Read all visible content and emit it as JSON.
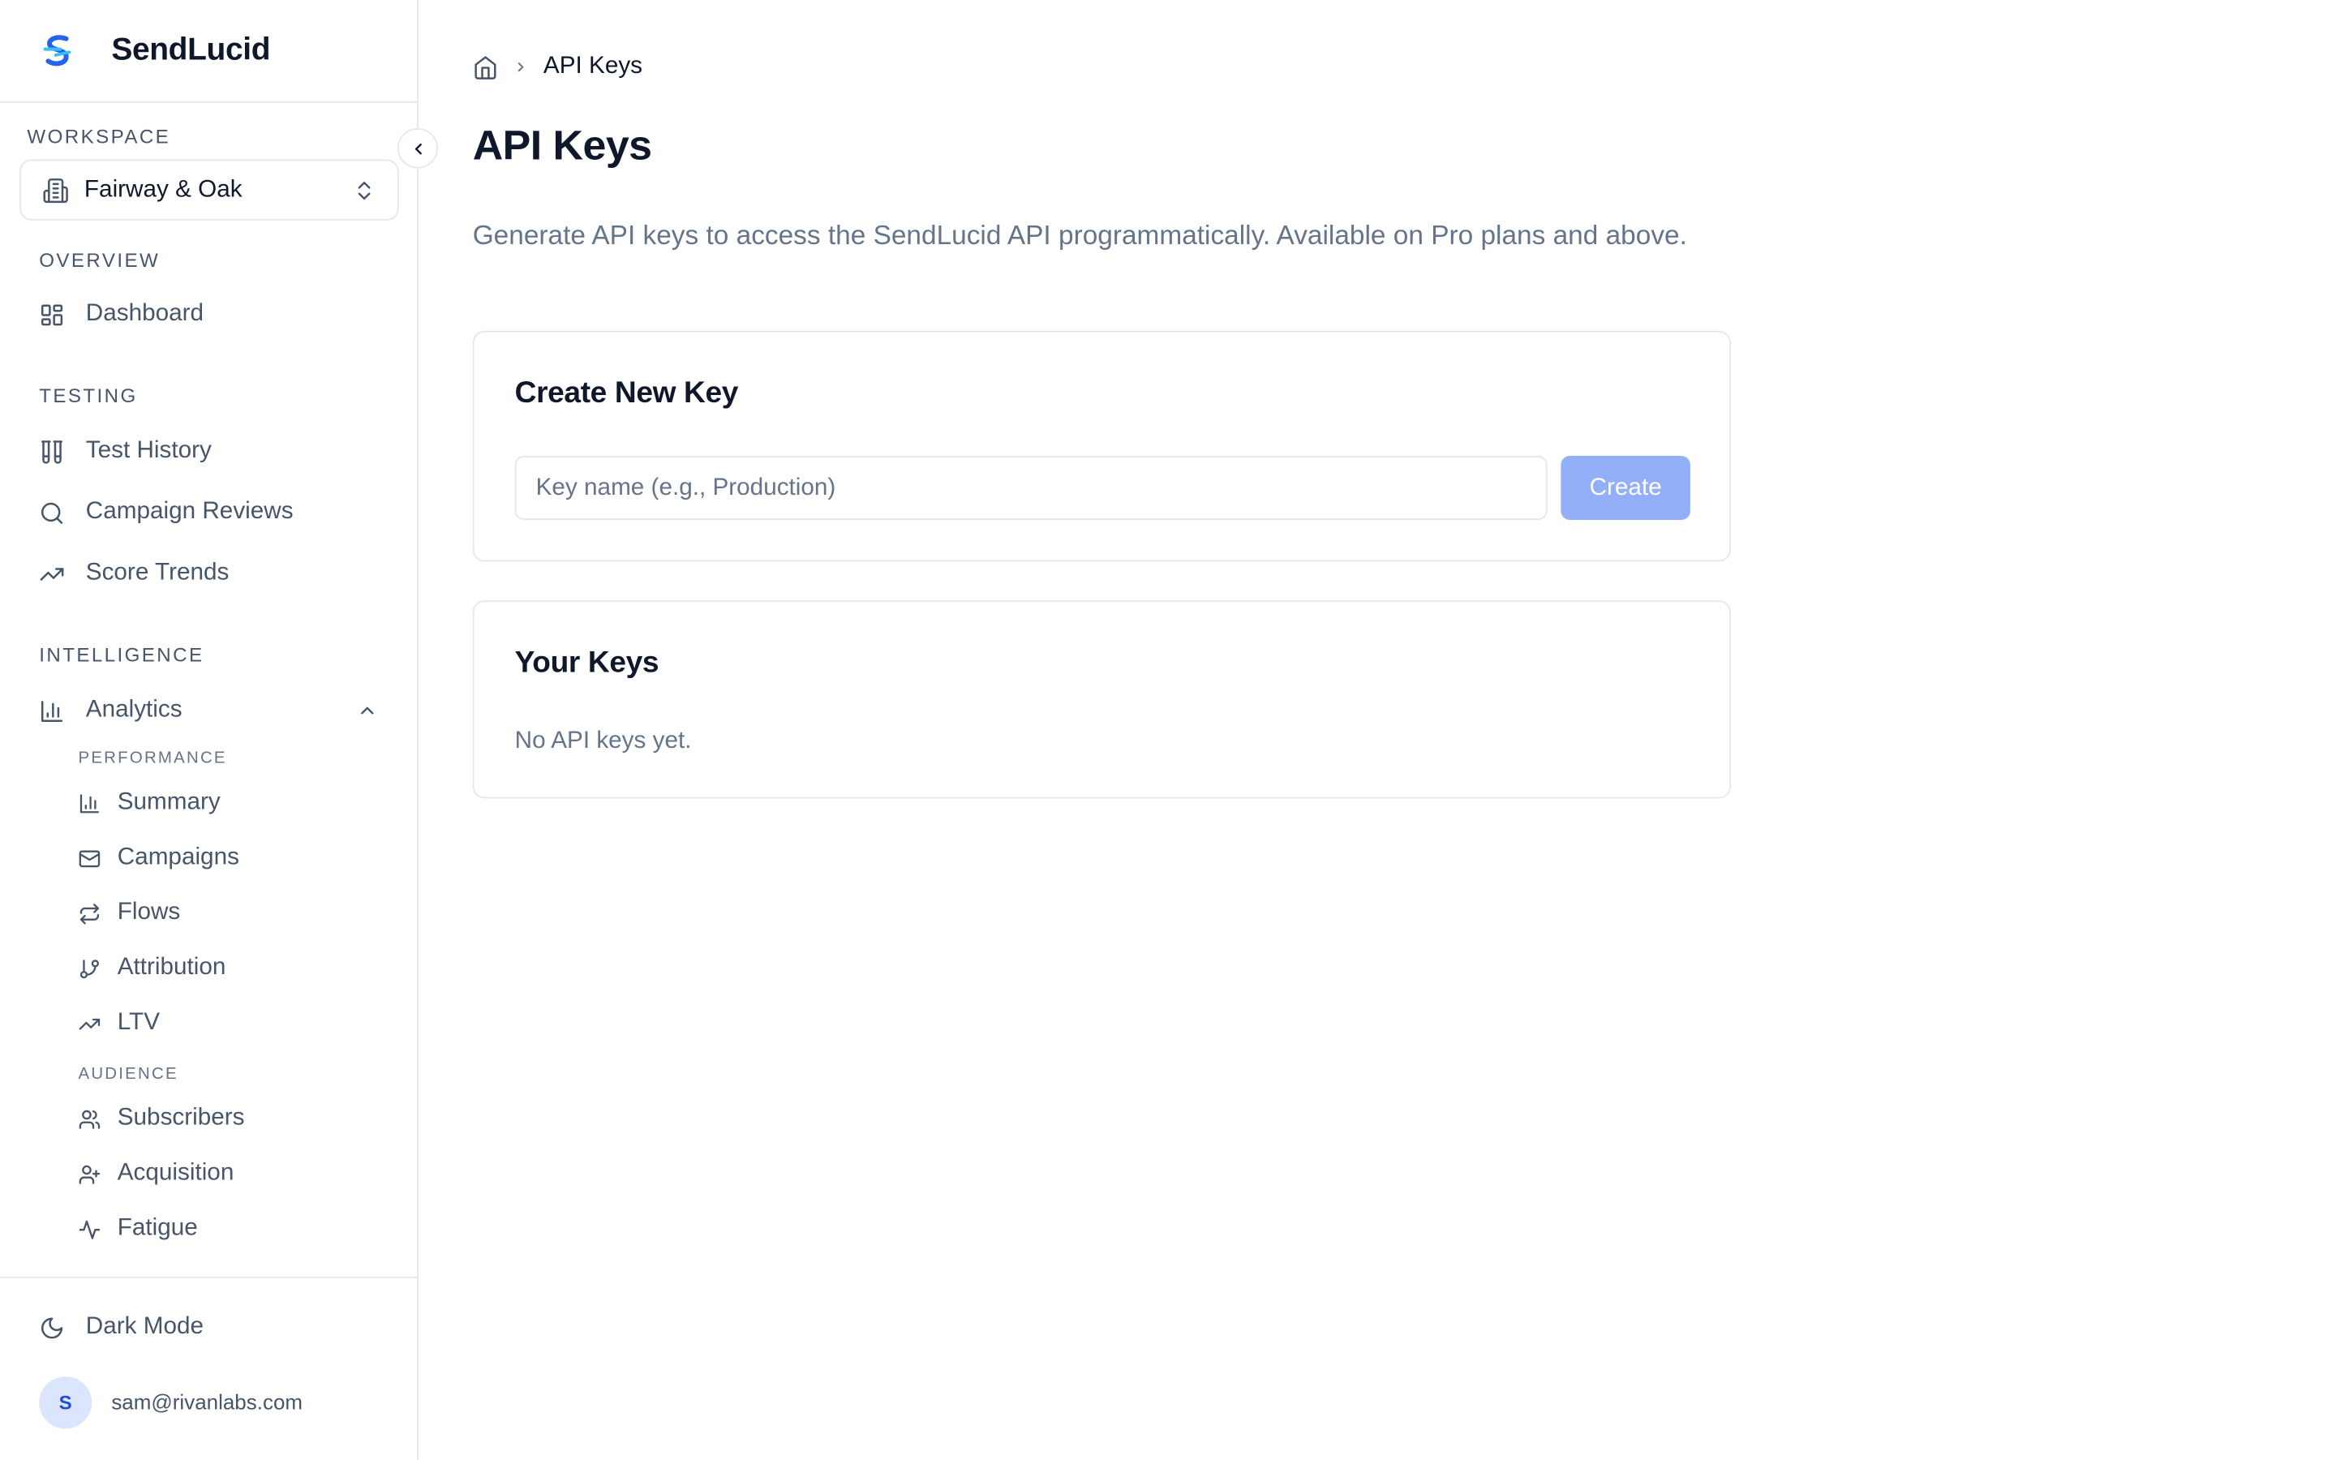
{
  "brand": {
    "name": "SendLucid"
  },
  "workspace": {
    "label": "WORKSPACE",
    "current": "Fairway & Oak"
  },
  "sidebar": {
    "overview_label": "OVERVIEW",
    "dashboard": "Dashboard",
    "testing_label": "TESTING",
    "testing_items": [
      "Test History",
      "Campaign Reviews",
      "Score Trends"
    ],
    "intelligence_label": "INTELLIGENCE",
    "analytics": "Analytics",
    "performance_label": "PERFORMANCE",
    "performance_items": [
      "Summary",
      "Campaigns",
      "Flows",
      "Attribution",
      "LTV"
    ],
    "audience_label": "AUDIENCE",
    "audience_items": [
      "Subscribers",
      "Acquisition",
      "Fatigue"
    ],
    "dark_mode": "Dark Mode",
    "user": {
      "initial": "S",
      "email": "sam@rivanlabs.com"
    }
  },
  "breadcrumb": {
    "current": "API Keys"
  },
  "page": {
    "title": "API Keys",
    "description": "Generate API keys to access the SendLucid API programmatically. Available on Pro plans and above."
  },
  "create_card": {
    "title": "Create New Key",
    "input_placeholder": "Key name (e.g., Production)",
    "input_value": "",
    "button": "Create"
  },
  "keys_card": {
    "title": "Your Keys",
    "empty": "No API keys yet."
  },
  "colors": {
    "accent_disabled": "#93aff7",
    "avatar_bg": "#dbe6fe",
    "logo_blue": "#2563eb",
    "logo_cyan": "#38bdf8"
  }
}
